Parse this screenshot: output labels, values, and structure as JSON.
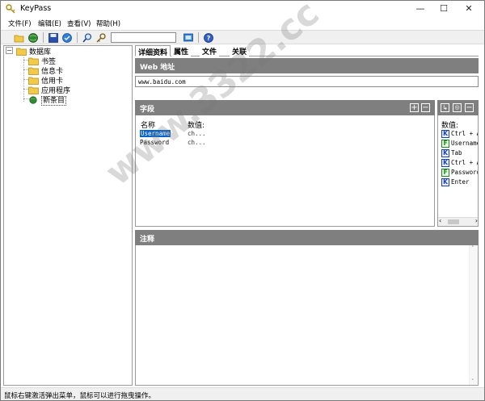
{
  "window": {
    "title": "KeyPass"
  },
  "menu": [
    "文件(F)",
    "编辑(E)",
    "查看(V)",
    "帮助(H)"
  ],
  "toolbar": {
    "search_value": ""
  },
  "tree": {
    "root": "数据库",
    "children": [
      "书签",
      "信息卡",
      "信用卡",
      "应用程序",
      "新条目"
    ],
    "selected": "新条目"
  },
  "tabs": [
    "详细资料",
    "属性",
    "文件",
    "关联"
  ],
  "web": {
    "header": "Web 地址",
    "url": "www.baidu.com"
  },
  "fields": {
    "header": "字段",
    "col_name": "名称",
    "col_value": "数值:",
    "rows": [
      {
        "name": "Username",
        "value": "ch..."
      },
      {
        "name": "Password",
        "value": "ch..."
      }
    ]
  },
  "values": {
    "header": "数值:",
    "rows": [
      {
        "badge": "K",
        "text": "Ctrl + A"
      },
      {
        "badge": "F",
        "text": "Username"
      },
      {
        "badge": "K",
        "text": "Tab"
      },
      {
        "badge": "K",
        "text": "Ctrl + A"
      },
      {
        "badge": "F",
        "text": "Password"
      },
      {
        "badge": "K",
        "text": "Enter"
      }
    ]
  },
  "notes": {
    "header": "注释"
  },
  "status": "鼠标右键激活弹出菜单，鼠标可以进行拖曳操作。",
  "watermark": "www.3322.cc",
  "colors": {
    "header_gray": "#7f7f7f",
    "selection_blue": "#0a64c8"
  }
}
